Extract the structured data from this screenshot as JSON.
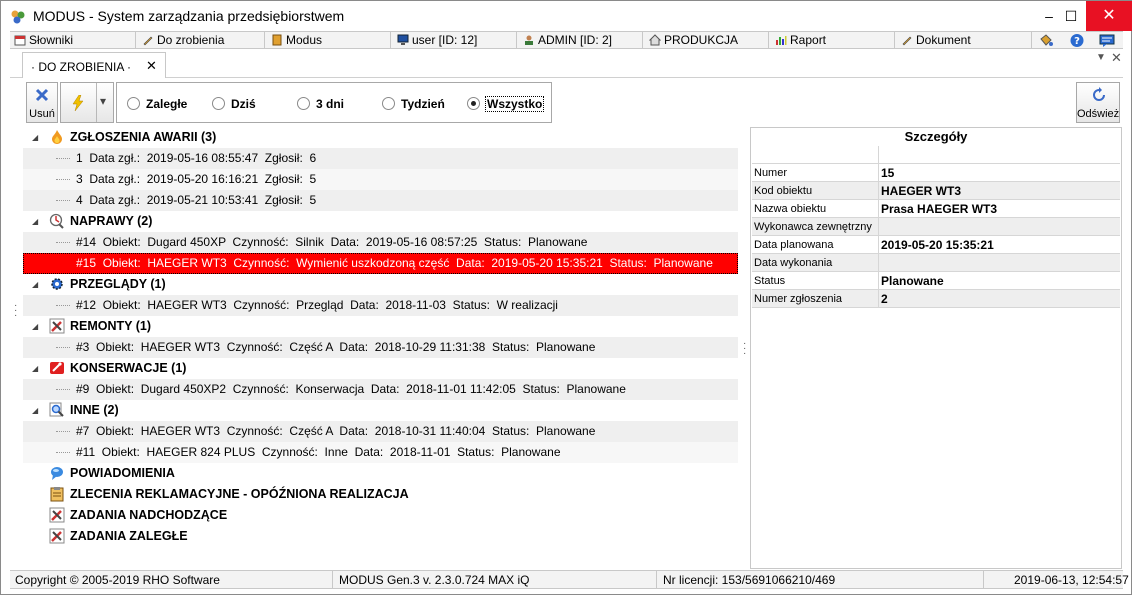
{
  "window": {
    "title": "MODUS - System zarządzania przedsiębiorstwem",
    "minimize_glyph": "–",
    "maximize_glyph": "☐",
    "close_glyph": "✕"
  },
  "modules": [
    {
      "label": "Słowniki",
      "icon": "calendar-icon"
    },
    {
      "label": "Do zrobienia",
      "icon": "pencil-icon"
    },
    {
      "label": "Modus",
      "icon": "book-icon"
    },
    {
      "label": "user [ID: 12]",
      "icon": "monitor-icon"
    },
    {
      "label": "ADMIN [ID: 2]",
      "icon": "user-icon"
    },
    {
      "label": "PRODUKCJA",
      "icon": "home-icon"
    },
    {
      "label": "Raport",
      "icon": "bar-chart-icon"
    },
    {
      "label": "Dokument",
      "icon": "pencil-icon"
    }
  ],
  "tab": {
    "label": "· DO ZROBIENIA ·",
    "close_glyph": "✕",
    "menu_glyph": "▼",
    "panel_close_glyph": "✕"
  },
  "toolbar": {
    "delete_label": "Usuń",
    "refresh_label": "Odśwież",
    "dropdown_glyph": "▾",
    "filters": [
      {
        "label": "Zaległe",
        "selected": false
      },
      {
        "label": "Dziś",
        "selected": false
      },
      {
        "label": "3 dni",
        "selected": false
      },
      {
        "label": "Tydzień",
        "selected": false
      },
      {
        "label": "Wszystko",
        "selected": true
      }
    ]
  },
  "tree": {
    "groups": [
      {
        "label": "ZGŁOSZENIA AWARII (3)",
        "icon": "fire-icon",
        "items": [
          "1  Data zgł.:  2019-05-16 08:55:47  Zgłosił:  6",
          "3  Data zgł.:  2019-05-20 16:16:21  Zgłosił:  5",
          "4  Data zgł.:  2019-05-21 10:53:41  Zgłosił:  5"
        ]
      },
      {
        "label": "NAPRAWY (2)",
        "icon": "repair-icon",
        "items": [
          "#14  Obiekt:  Dugard 450XP  Czynność:  Silnik  Data:  2019-05-16 08:57:25  Status:  Planowane",
          "#15  Obiekt:  HAEGER WT3  Czynność:  Wymienić uszkodzoną część  Data:  2019-05-20 15:35:21  Status:  Planowane"
        ],
        "selected_index": 1
      },
      {
        "label": "PRZEGLĄDY (1)",
        "icon": "gear-icon",
        "items": [
          "#12  Obiekt:  HAEGER WT3  Czynność:  Przegląd  Data:  2018-11-03  Status:  W realizacji"
        ]
      },
      {
        "label": "REMONTY (1)",
        "icon": "tools-icon",
        "items": [
          "#3  Obiekt:  HAEGER WT3  Czynność:  Część A  Data:  2018-10-29 11:31:38  Status:  Planowane"
        ]
      },
      {
        "label": "KONSERWACJE (1)",
        "icon": "maintenance-icon",
        "items": [
          "#9  Obiekt:  Dugard 450XP2  Czynność:  Konserwacja  Data:  2018-11-01 11:42:05  Status:  Planowane"
        ]
      },
      {
        "label": "INNE (2)",
        "icon": "magnifier-icon",
        "items": [
          "#7  Obiekt:  HAEGER WT3  Czynność:  Część A  Data:  2018-10-31 11:40:04  Status:  Planowane",
          "#11  Obiekt:  HAEGER 824 PLUS  Czynność:  Inne  Data:  2018-11-01  Status:  Planowane"
        ]
      },
      {
        "label": "POWIADOMIENIA",
        "icon": "chat-bubble-icon",
        "items": []
      },
      {
        "label": "ZLECENIA REKLAMACYJNE - OPÓŹNIONA REALIZACJA",
        "icon": "clipboard-icon",
        "items": []
      },
      {
        "label": "ZADANIA NADCHODZĄCE",
        "icon": "tools-icon",
        "items": []
      },
      {
        "label": "ZADANIA ZALEGŁE",
        "icon": "tools-icon",
        "items": []
      }
    ]
  },
  "details": {
    "title": "Szczegóły",
    "rows": [
      {
        "key": "",
        "value": ""
      },
      {
        "key": "Numer",
        "value": "15"
      },
      {
        "key": "Kod obiektu",
        "value": "HAEGER WT3"
      },
      {
        "key": "Nazwa obiektu",
        "value": "Prasa HAEGER WT3"
      },
      {
        "key": "Wykonawca zewnętrzny",
        "value": ""
      },
      {
        "key": "Data planowana",
        "value": "2019-05-20 15:35:21"
      },
      {
        "key": "Data wykonania",
        "value": ""
      },
      {
        "key": "Status",
        "value": "Planowane"
      },
      {
        "key": "Numer zgłoszenia",
        "value": "2"
      }
    ]
  },
  "statusbar": {
    "copyright": "Copyright © 2005-2019 RHO Software",
    "version": "MODUS Gen.3 v. 2.3.0.724 MAX iQ",
    "license": "Nr licencji:  153/5691066210/469",
    "datetime": "2019-06-13,   12:54:57"
  },
  "colors": {
    "selection": "#ff0000",
    "close_button": "#e81123"
  }
}
